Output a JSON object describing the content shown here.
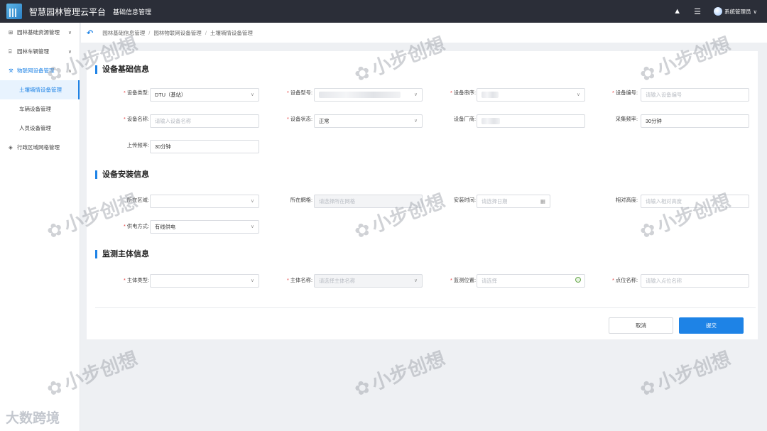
{
  "header": {
    "app_title": "智慧园林管理云平台",
    "module_title": "基础信息管理",
    "user_name": "系统管理员"
  },
  "sidebar": {
    "items": [
      {
        "label": "园林基础资源管理",
        "icon": "grid-icon"
      },
      {
        "label": "园林车辆管理",
        "icon": "car-icon"
      },
      {
        "label": "物联网设备管理",
        "icon": "tools-icon"
      }
    ],
    "subitems": [
      {
        "label": "土壤墒情设备管理"
      },
      {
        "label": "车辆设备管理"
      },
      {
        "label": "人员设备管理"
      }
    ],
    "last_item": {
      "label": "行政区域网格管理",
      "icon": "layers-icon"
    }
  },
  "breadcrumb": [
    "园林基础信息管理",
    "园林物联网设备管理",
    "土壤墒情设备管理"
  ],
  "sections": {
    "basic": "设备基础信息",
    "install": "设备安装信息",
    "monitor": "监测主体信息"
  },
  "fields": {
    "device_type": {
      "label": "设备类型:",
      "value": "DTU（基站）"
    },
    "device_model": {
      "label": "设备型号:"
    },
    "device_serial": {
      "label": "设备串序:"
    },
    "device_number": {
      "label": "设备编号:",
      "placeholder": "请输入设备编号"
    },
    "device_name": {
      "label": "设备名称:",
      "placeholder": "请输入设备名称"
    },
    "device_status": {
      "label": "设备状态:",
      "value": "正常"
    },
    "manufacturer": {
      "label": "设备厂商:"
    },
    "sample_freq": {
      "label": "采集频率:",
      "value": "30分钟"
    },
    "upload_freq": {
      "label": "上传频率:",
      "value": "30分钟"
    },
    "region": {
      "label": "所在区域:"
    },
    "grid": {
      "label": "所在網格:",
      "placeholder": "请选择所在网格"
    },
    "install_time": {
      "label": "安装时间:",
      "placeholder": "请选择日期"
    },
    "relative_height": {
      "label": "相对高度:",
      "placeholder": "请输入相对高度"
    },
    "power_mode": {
      "label": "供电方式:",
      "value": "有线供电"
    },
    "subject_type": {
      "label": "主体类型:"
    },
    "subject_name": {
      "label": "主体名称:",
      "placeholder": "请选择主体名称"
    },
    "monitor_location": {
      "label": "监测位置:",
      "placeholder": "请选择"
    },
    "point_name": {
      "label": "点位名称:",
      "placeholder": "请输入点位名称"
    }
  },
  "buttons": {
    "cancel": "取消",
    "submit": "提交"
  },
  "watermarks": {
    "text": "小步创想",
    "corner": "大数跨境"
  },
  "colors": {
    "accent": "#1e83e6",
    "topbar": "#2b2e38",
    "required": "#e53e3e"
  }
}
